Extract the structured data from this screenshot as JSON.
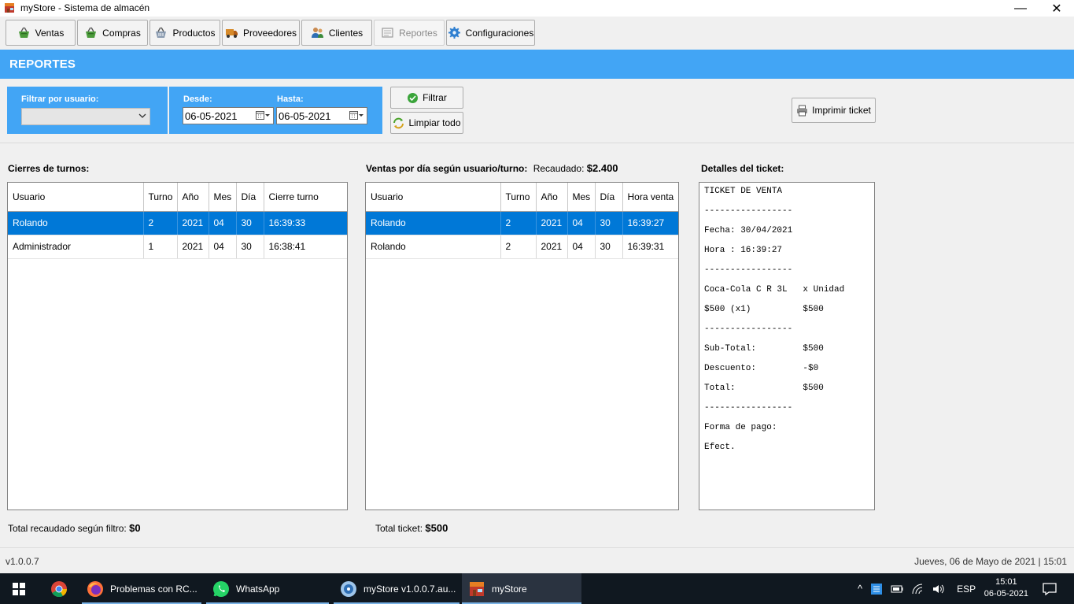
{
  "window": {
    "title": "myStore - Sistema de almacén",
    "minimize_glyph": "—",
    "close_glyph": "✕",
    "icon": "store-icon"
  },
  "toolbar": [
    {
      "label": "Ventas",
      "icon": "basket-icon",
      "enabled": true
    },
    {
      "label": "Compras",
      "icon": "basket-icon",
      "enabled": true
    },
    {
      "label": "Productos",
      "icon": "basket-outline-icon",
      "enabled": true
    },
    {
      "label": "Proveedores",
      "icon": "truck-icon",
      "enabled": true
    },
    {
      "label": "Clientes",
      "icon": "users-icon",
      "enabled": true
    },
    {
      "label": "Reportes",
      "icon": "report-icon",
      "enabled": false
    },
    {
      "label": "Configuraciones",
      "icon": "gear-icon",
      "enabled": true
    }
  ],
  "section_title": "REPORTES",
  "filters": {
    "user_label": "Filtrar por usuario:",
    "user_value": "",
    "from_label": "Desde:",
    "from_value": "06-05-2021",
    "to_label": "Hasta:",
    "to_value": "06-05-2021",
    "filter_button": "Filtrar",
    "clear_button": "Limpiar todo",
    "print_button": "Imprimir ticket"
  },
  "shifts": {
    "label": "Cierres de turnos:",
    "columns": [
      "Usuario",
      "Turno",
      "Año",
      "Mes",
      "Día",
      "Cierre turno"
    ],
    "rows": [
      [
        "Rolando",
        "2",
        "2021",
        "04",
        "30",
        "16:39:33"
      ],
      [
        "Administrador",
        "1",
        "2021",
        "04",
        "30",
        "16:38:41"
      ]
    ],
    "selected_row": 0,
    "total_label": "Total recaudado según filtro:",
    "total_value": "$0"
  },
  "sales": {
    "label": "Ventas por día según usuario/turno:",
    "collected_label": "Recaudado:",
    "collected_value": "$2.400",
    "columns": [
      "Usuario",
      "Turno",
      "Año",
      "Mes",
      "Día",
      "Hora venta"
    ],
    "rows": [
      [
        "Rolando",
        "2",
        "2021",
        "04",
        "30",
        "16:39:27"
      ],
      [
        "Rolando",
        "2",
        "2021",
        "04",
        "30",
        "16:39:31"
      ]
    ],
    "selected_row": 0,
    "total_label": "Total ticket:",
    "total_value": "$500"
  },
  "ticket": {
    "label": "Detalles del ticket:",
    "lines": [
      "TICKET DE VENTA",
      "-----------------",
      "Fecha: 30/04/2021",
      "Hora : 16:39:27",
      "-----------------",
      "Coca-Cola C R 3L   x Unidad",
      "$500 (x1)          $500",
      "-----------------",
      "Sub-Total:         $500",
      "Descuento:         -$0",
      "Total:             $500",
      "-----------------",
      "Forma de pago:",
      "Efect."
    ]
  },
  "status": {
    "version": "v1.0.0.7",
    "datetime": "Jueves, 06 de Mayo de 2021 | 15:01"
  },
  "taskbar": {
    "items": [
      {
        "label": "",
        "icon": "windows-start-icon"
      },
      {
        "label": "",
        "icon": "chrome-icon"
      },
      {
        "label": "Problemas con RC...",
        "icon": "firefox-icon"
      },
      {
        "label": "WhatsApp",
        "icon": "whatsapp-icon"
      },
      {
        "label": "myStore v1.0.0.7.au...",
        "icon": "installer-icon"
      },
      {
        "label": "myStore",
        "icon": "store-icon"
      }
    ],
    "language": "ESP",
    "time": "15:01",
    "date": "06-05-2021"
  },
  "colors": {
    "accent": "#42a5f5",
    "selection": "#0078d7",
    "taskbar": "#101820"
  }
}
